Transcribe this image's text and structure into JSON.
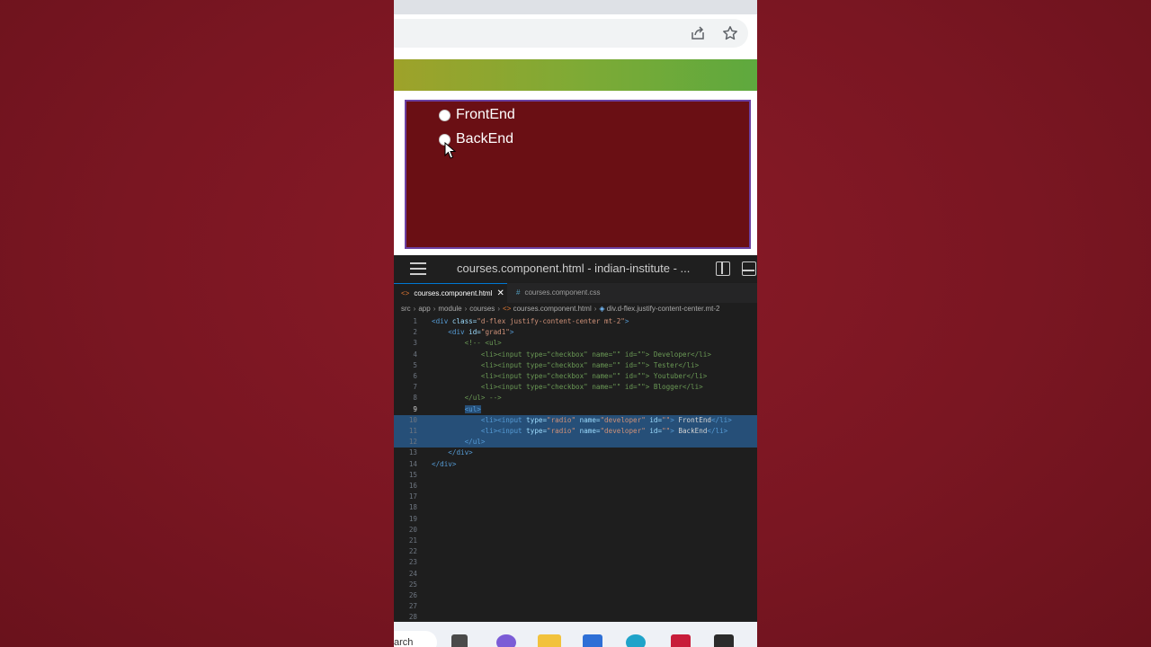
{
  "colors": {
    "background": "#7a1622",
    "panel": "#6a0f14",
    "panel_border": "#6b3fa0",
    "selection": "#264f78"
  },
  "browser": {
    "icons": [
      "share-icon",
      "star-icon"
    ]
  },
  "radios": [
    {
      "label": "FrontEnd"
    },
    {
      "label": "BackEnd"
    }
  ],
  "vscode": {
    "title": "courses.component.html - indian-institute - ...",
    "tabs": [
      {
        "label": "courses.component.html",
        "icon": "<>",
        "active": true
      },
      {
        "label": "courses.component.css",
        "icon": "#",
        "active": false
      }
    ],
    "breadcrumb": [
      "src",
      "app",
      "module",
      "courses",
      "courses.component.html",
      "div.d-flex.justify-content-center.mt-2"
    ]
  },
  "taskbar": {
    "search": "arch"
  }
}
